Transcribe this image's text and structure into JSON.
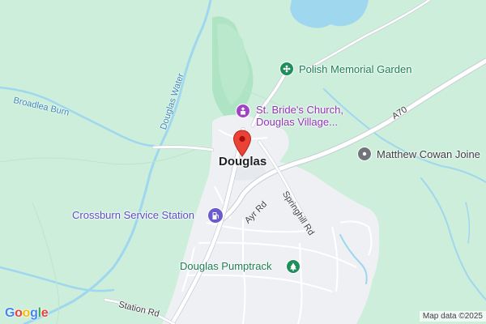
{
  "map": {
    "place_label": "Douglas",
    "pois": [
      {
        "name": "Polish Memorial Garden",
        "category": "park",
        "icon": "flower-icon",
        "color": "#1e8e5a"
      },
      {
        "name_line1": "St. Bride's Church,",
        "name_line2": "Douglas Village...",
        "category": "church",
        "icon": "church-icon",
        "color": "#a142c9"
      },
      {
        "name": "Matthew Cowan Joine",
        "category": "generic",
        "icon": "pin-dot-icon",
        "color": "#70757a"
      },
      {
        "name": "Crossburn Service Station",
        "category": "fuel",
        "icon": "fuel-pump-icon",
        "color": "#6a5acd"
      },
      {
        "name": "Douglas Pumptrack",
        "category": "park",
        "icon": "tree-icon",
        "color": "#1e8e5a"
      }
    ],
    "water_labels": [
      "Broadlea Burn",
      "Douglas Water"
    ],
    "road_labels": [
      "A70",
      "Ayr Rd",
      "Springhill Rd",
      "Station Rd"
    ],
    "marker": {
      "icon": "map-pin-icon",
      "color": "#ea4335"
    },
    "attribution": "Map data ©2025",
    "logo": {
      "text": "Google",
      "letters": [
        "G",
        "o",
        "o",
        "g",
        "l",
        "e"
      ],
      "colors": [
        "#4285f4",
        "#ea4335",
        "#fbbc05",
        "#4285f4",
        "#34a853",
        "#ea4335"
      ]
    },
    "colors": {
      "land": "#cdeedb",
      "park": "#aee3c4",
      "water": "#9fd7ee",
      "town": "#eef0f3",
      "road": "#ffffff",
      "road_casing": "#c7cdd3"
    }
  }
}
